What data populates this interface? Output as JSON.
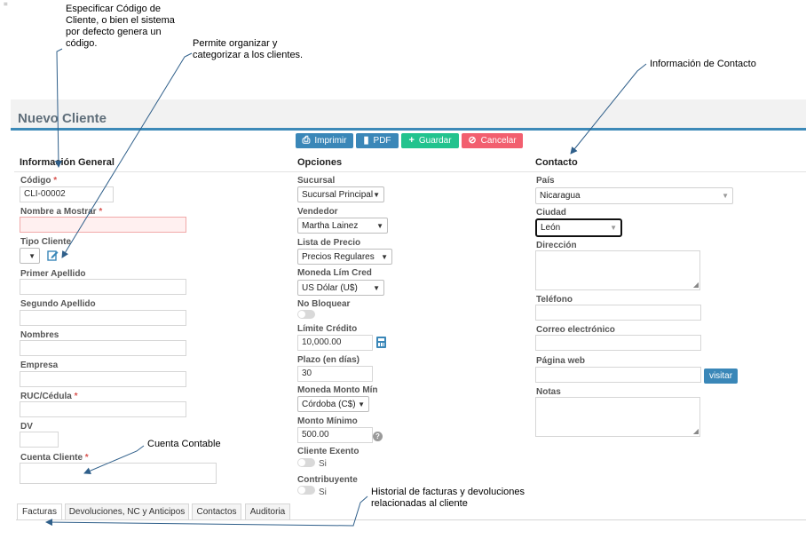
{
  "annotations": {
    "codigo_note": [
      "Especificar Código de",
      "Cliente, o bien el sistema",
      "por defecto genera un",
      "código."
    ],
    "tipo_note": [
      "Permite organizar y",
      "categorizar a los clientes."
    ],
    "contacto_note": "Información de Contacto",
    "cuenta_note": "Cuenta Contable",
    "historial_note": [
      "Historial de facturas y devoluciones",
      "relacionadas al cliente"
    ]
  },
  "page": {
    "title": "Nuevo Cliente"
  },
  "toolbar": {
    "print": "Imprimir",
    "pdf": "PDF",
    "save": "Guardar",
    "cancel": "Cancelar"
  },
  "general": {
    "title": "Información General",
    "codigo_label": "Código",
    "codigo_value": "CLI-00002",
    "nombre_label": "Nombre a Mostrar",
    "tipo_label": "Tipo Cliente",
    "primer_apellido_label": "Primer Apellido",
    "segundo_apellido_label": "Segundo Apellido",
    "nombres_label": "Nombres",
    "empresa_label": "Empresa",
    "ruc_label": "RUC/Cédula",
    "dv_label": "DV",
    "cuenta_label": "Cuenta Cliente",
    "required_mark": "*"
  },
  "opciones": {
    "title": "Opciones",
    "sucursal_label": "Sucursal",
    "sucursal_value": "Sucursal Principal",
    "vendedor_label": "Vendedor",
    "vendedor_value": "Martha Lainez",
    "lista_label": "Lista de Precio",
    "lista_value": "Precios Regulares",
    "moneda_lim_label": "Moneda Lím Cred",
    "moneda_lim_value": "US Dólar (U$)",
    "no_bloquear_label": "No Bloquear",
    "limite_label": "Límite Crédito",
    "limite_value": "10,000.00",
    "plazo_label": "Plazo (en días)",
    "plazo_value": "30",
    "moneda_min_label": "Moneda Monto Mín",
    "moneda_min_value": "Córdoba (C$)",
    "monto_min_label": "Monto Mínimo",
    "monto_min_value": "500.00",
    "exento_label": "Cliente Exento",
    "exento_text": "Si",
    "contribuyente_label": "Contribuyente",
    "contribuyente_text": "Si"
  },
  "contacto": {
    "title": "Contacto",
    "pais_label": "País",
    "pais_value": "Nicaragua",
    "ciudad_label": "Ciudad",
    "ciudad_value": "León",
    "direccion_label": "Dirección",
    "telefono_label": "Teléfono",
    "correo_label": "Correo electrónico",
    "web_label": "Página web",
    "visitar": "visitar",
    "notas_label": "Notas"
  },
  "tabs": [
    "Facturas",
    "Devoluciones, NC y Anticipos",
    "Contactos",
    "Auditoria"
  ],
  "colors": {
    "primary": "#3a87b8",
    "success": "#22c38e",
    "danger": "#f25f6f",
    "header_line": "#3d8ab8"
  }
}
